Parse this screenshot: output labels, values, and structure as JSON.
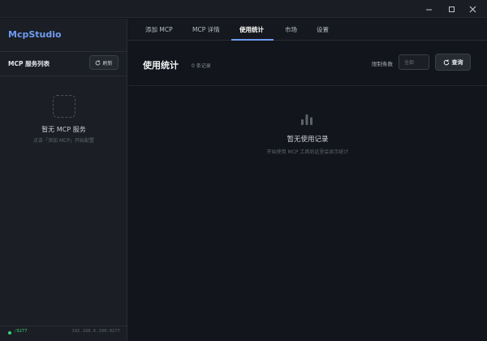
{
  "window": {
    "minimize_glyph": "—",
    "maximize_glyph": "☐",
    "close_glyph": "✕"
  },
  "sidebar": {
    "brand": "McpStudio",
    "list_title": "MCP 服务列表",
    "refresh_label": "刷新",
    "empty_title": "暂无 MCP 服务",
    "empty_hint": "点击「添加 MCP」开始配置",
    "status": {
      "port": ":9277",
      "address": "192.168.6.100:9277",
      "color": "#3ecf7a"
    }
  },
  "tabs": [
    {
      "label": "添加 MCP"
    },
    {
      "label": "MCP 详情"
    },
    {
      "label": "使用统计",
      "active": true
    },
    {
      "label": "市场"
    },
    {
      "label": "设置"
    }
  ],
  "main": {
    "title": "使用统计",
    "record_count": "0 条记录",
    "limit_label": "限制条数",
    "limit_value": "全部",
    "query_label": "查询",
    "empty_title": "暂无使用记录",
    "empty_hint": "开始使用 MCP 工具后这里会显示统计"
  },
  "colors": {
    "accent": "#6f9cf2",
    "background": "#12151b",
    "sidebar": "#1b1e24"
  },
  "icons": {
    "refresh": "refresh-icon",
    "empty_box": "dashed-box-icon",
    "stats": "bar-chart-icon"
  }
}
